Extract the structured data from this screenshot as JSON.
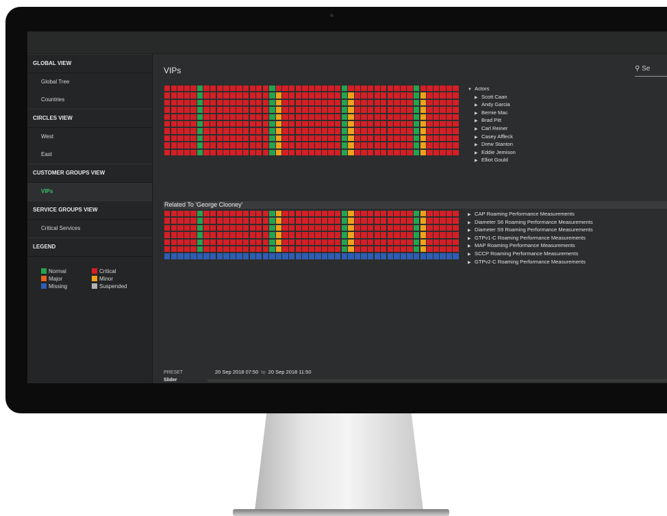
{
  "colors": {
    "normal": "#24a350",
    "critical": "#d41f26",
    "major": "#e3641e",
    "minor": "#f0a21c",
    "missing": "#2d5db4",
    "suspended": "#b3b3b3"
  },
  "sidebar": {
    "sections": [
      {
        "title": "GLOBAL VIEW",
        "items": [
          {
            "label": "Global Tree"
          },
          {
            "label": "Countries"
          }
        ]
      },
      {
        "title": "CIRCLES VIEW",
        "items": [
          {
            "label": "West"
          },
          {
            "label": "East"
          }
        ]
      },
      {
        "title": "CUSTOMER GROUPS VIEW",
        "items": [
          {
            "label": "VIPs",
            "active": true
          }
        ]
      },
      {
        "title": "SERVICE GROUPS VIEW",
        "items": [
          {
            "label": "Critical Services"
          }
        ]
      }
    ],
    "legend_title": "LEGEND",
    "legend": [
      {
        "label": "Normal",
        "key": "normal"
      },
      {
        "label": "Critical",
        "key": "critical"
      },
      {
        "label": "Major",
        "key": "major"
      },
      {
        "label": "Minor",
        "key": "minor"
      },
      {
        "label": "Missing",
        "key": "missing"
      },
      {
        "label": "Suspended",
        "key": "suspended"
      }
    ]
  },
  "main": {
    "title": "VIPs",
    "search_label": "Se",
    "actors_header": "Actors",
    "actors": [
      "Scott Caan",
      "Andy Garcia",
      "Bernie Mac",
      "Brad Pitt",
      "Carl Reiner",
      "Casey Affleck",
      "Drew Stanton",
      "Eddie Jemison",
      "Elliot Gould"
    ],
    "related_title": "Related To 'George Clooney'",
    "services": [
      "CAP Roaming Performance Measurements",
      "Diameter S6 Roaming Performance Measurements",
      "Diameter S9 Roaming Performance Measurements",
      "GTPv1-C Roaming Performance Measurements",
      "MAP Roaming Performance Measurements",
      "SCCP Roaming Performance Measurements",
      "GTPv2-C Roaming Performance Measurements"
    ],
    "heatmap": {
      "columns": 45,
      "green_columns": [
        5,
        16,
        27,
        38
      ],
      "orange_columns": [
        17,
        28,
        39
      ],
      "missing_rows_in_services": [
        6
      ]
    }
  },
  "footer": {
    "preset_label": "PRESET",
    "range_from": "20 Sep 2018 07:50",
    "range_to_word": "to",
    "range_to": "20 Sep 2018 11:50",
    "slider_label": "Slider"
  }
}
